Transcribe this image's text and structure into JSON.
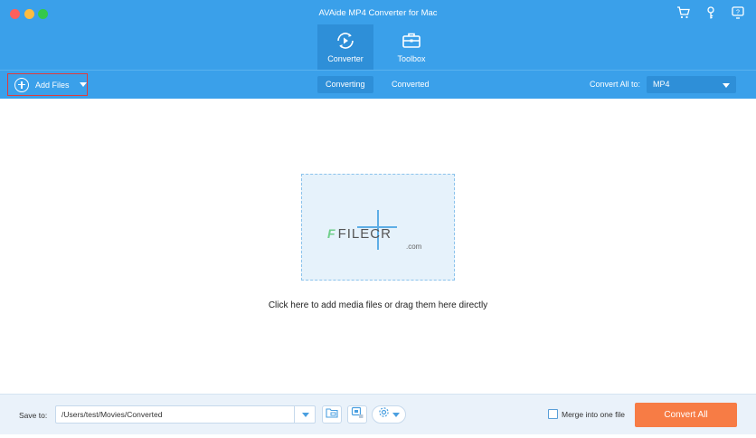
{
  "window": {
    "title": "AVAide MP4 Converter for Mac"
  },
  "top_icons": [
    "cart-icon",
    "key-icon",
    "help-icon"
  ],
  "mode_tabs": [
    {
      "label": "Converter",
      "icon": "converter-icon",
      "active": true
    },
    {
      "label": "Toolbox",
      "icon": "toolbox-icon",
      "active": false
    }
  ],
  "toolbar": {
    "add_files_label": "Add Files",
    "tabs": [
      {
        "label": "Converting",
        "active": true
      },
      {
        "label": "Converted",
        "active": false
      }
    ],
    "convert_all_label": "Convert All to:",
    "format_value": "MP4"
  },
  "main": {
    "drop_hint": "Click here to add media files or drag them here directly",
    "watermark": {
      "mark": "F",
      "name": "FILECR",
      "suffix": ".com"
    }
  },
  "footer": {
    "save_to_label": "Save to:",
    "save_path": "/Users/test/Movies/Converted",
    "merge_label": "Merge into one file",
    "merge_checked": false,
    "convert_all_button": "Convert All"
  },
  "colors": {
    "header_blue": "#3aa0ea",
    "active_tab_blue": "#2e8fd8",
    "convert_orange": "#f77c45",
    "footer_bg": "#eaf2fa",
    "dropzone_bg": "#e6f2fb"
  }
}
